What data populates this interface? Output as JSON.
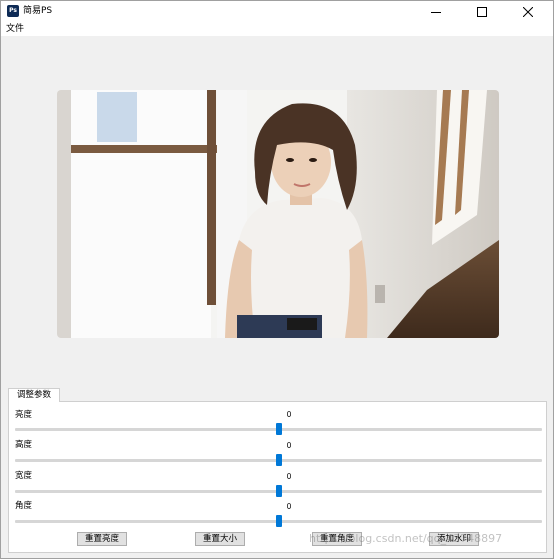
{
  "window": {
    "title": "简易PS",
    "app_icon_text": "Ps",
    "controls": [
      "minimize-icon",
      "maximize-icon",
      "close-icon"
    ]
  },
  "menu": {
    "file_label": "文件"
  },
  "image": {
    "description_icon": "photo-image"
  },
  "params_tab": {
    "label": "调整参数"
  },
  "params": [
    {
      "label": "亮度",
      "value": "0",
      "level": 0.5
    },
    {
      "label": "高度",
      "value": "0",
      "level": 0.5
    },
    {
      "label": "宽度",
      "value": "0",
      "level": 0.5
    },
    {
      "label": "角度",
      "value": "0",
      "level": 0.5
    }
  ],
  "buttons": {
    "reset_brightness": "重置亮度",
    "reset_size": "重置大小",
    "reset_angle": "重置角度",
    "add_watermark": "添加水印"
  },
  "watermark_text": "https://blog.csdn.net/qq_43748897",
  "colors": {
    "accent": "#0078d7",
    "app_icon_bg": "#0d2a55"
  }
}
